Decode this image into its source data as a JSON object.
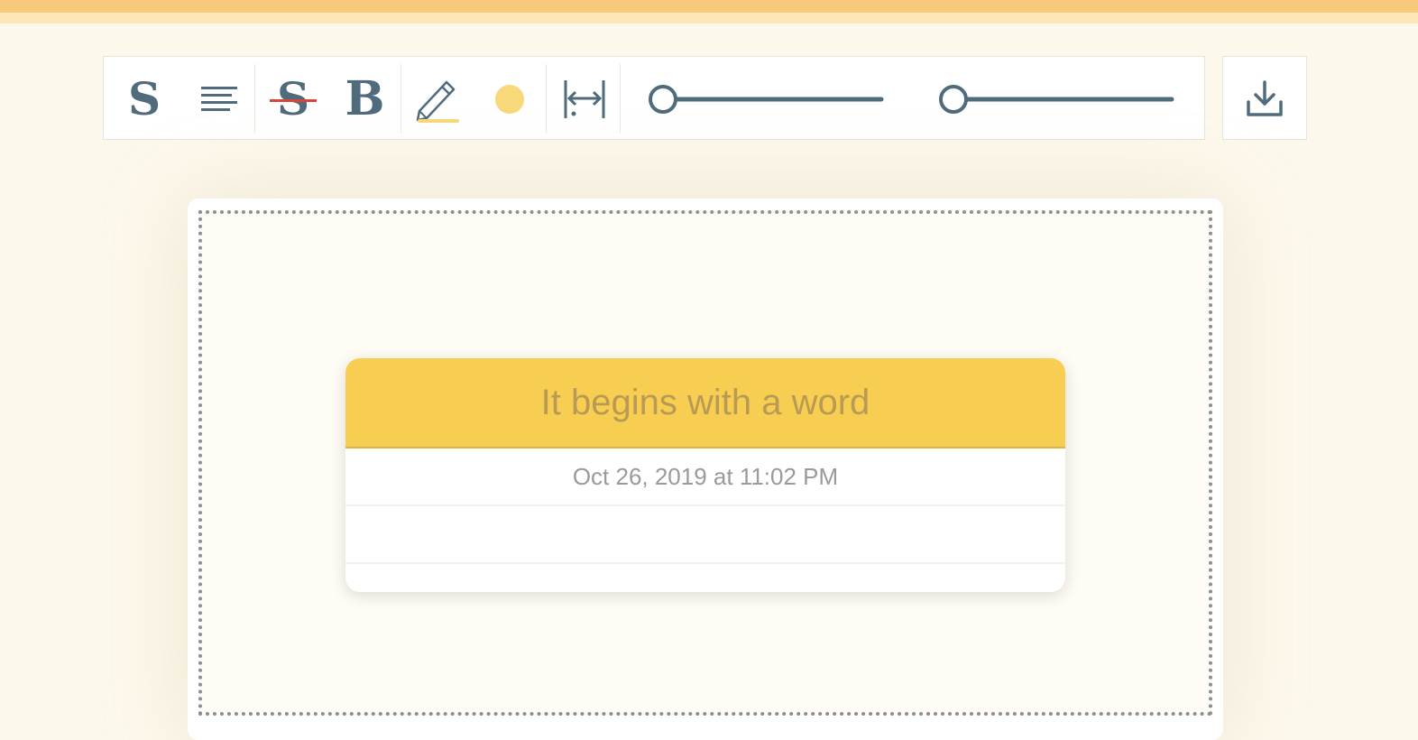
{
  "toolbar": {
    "font_icon": "S",
    "bold_icon": "B",
    "strike_icon": "S",
    "tools": [
      {
        "name": "font-style-icon"
      },
      {
        "name": "text-align-icon"
      },
      {
        "name": "strikethrough-icon"
      },
      {
        "name": "bold-icon"
      },
      {
        "name": "highlight-pencil-icon"
      },
      {
        "name": "color-dot-icon"
      },
      {
        "name": "width-adjust-icon"
      },
      {
        "name": "slider-1"
      },
      {
        "name": "slider-2"
      }
    ],
    "slider_1_value": 0,
    "slider_2_value": 0,
    "icon_color": "#4f6b7c",
    "accent_color": "#f8d878",
    "strike_color": "#d9443a"
  },
  "export": {
    "icon": "download-icon"
  },
  "card": {
    "title": "It begins with a word",
    "date": "Oct 26, 2019 at 11:02 PM",
    "header_color": "#f8ce52"
  }
}
